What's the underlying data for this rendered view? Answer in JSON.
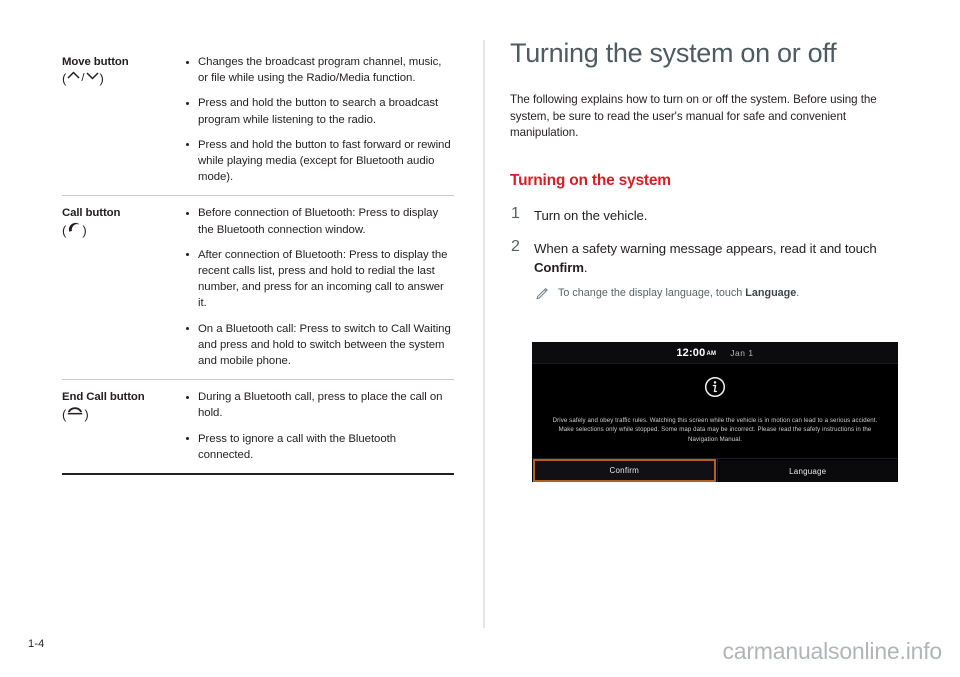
{
  "document": {
    "page_number": "1-4",
    "watermark": "carmanualsonline.info"
  },
  "left_column": {
    "table_rows": [
      {
        "label": "Move button",
        "icon_text": "(∧/∨)",
        "icons": [
          "chevron-up-icon",
          "chevron-down-icon"
        ],
        "bullets": [
          "Changes the broadcast program channel, music, or file while using the Radio/Media function.",
          "Press and hold the button to search a broadcast program while listening to the radio.",
          "Press and hold the button to fast forward or rewind while playing media (except for Bluetooth audio mode)."
        ]
      },
      {
        "label": "Call button",
        "icon_text": "(☎)",
        "icons": [
          "phone-handset-icon"
        ],
        "bullets": [
          "Before connection of Bluetooth: Press to display the Bluetooth connection window.",
          "After connection of Bluetooth: Press to display the recent calls list, press and hold to redial the last number, and press for an incoming call to answer it.",
          "On a Bluetooth call: Press to switch to Call Waiting and press and hold to switch between the system and mobile phone."
        ]
      },
      {
        "label": "End Call button",
        "icon_text": "(☏)",
        "icons": [
          "end-call-icon"
        ],
        "bullets": [
          "During a Bluetooth call, press to place the call on hold.",
          "Press to ignore a call with the Bluetooth connected."
        ]
      }
    ]
  },
  "right_column": {
    "heading": "Turning the system on or off",
    "intro": "The following explains how to turn on or off the system. Before using the system, be sure to read the user's manual for safe and convenient manipulation.",
    "subheading": "Turning on the system",
    "steps": [
      {
        "number": "1",
        "text_plain": "Turn on the vehicle.",
        "text_before": "Turn on the vehicle.",
        "bold": "",
        "text_after": ""
      },
      {
        "number": "2",
        "text_plain": "When a safety warning message appears, read it and touch Confirm.",
        "text_before": "When a safety warning message appears, read it and touch ",
        "bold": "Confirm",
        "text_after": "."
      }
    ],
    "note": {
      "icon": "pencil-icon",
      "text_before": "To change the display language, touch ",
      "bold": "Language",
      "text_after": "."
    },
    "colors": {
      "heading": "#4e5c60",
      "subheading": "#d81e24",
      "body": "#231f20"
    }
  },
  "device_screenshot": {
    "status_bar": {
      "time": "12:00",
      "am_pm": "AM",
      "date": "Jan 1"
    },
    "icon": "info-icon",
    "message": "Drive safely and obey traffic rules. Watching this screen while the vehicle is in motion can lead to a serious accident. Make selections only while stopped. Some map data may be incorrect. Please read the safety instructions in the Navigation Manual.",
    "buttons": [
      {
        "label": "Confirm",
        "selected": true
      },
      {
        "label": "Language",
        "selected": false
      }
    ],
    "highlight_color": "#b5611f"
  }
}
